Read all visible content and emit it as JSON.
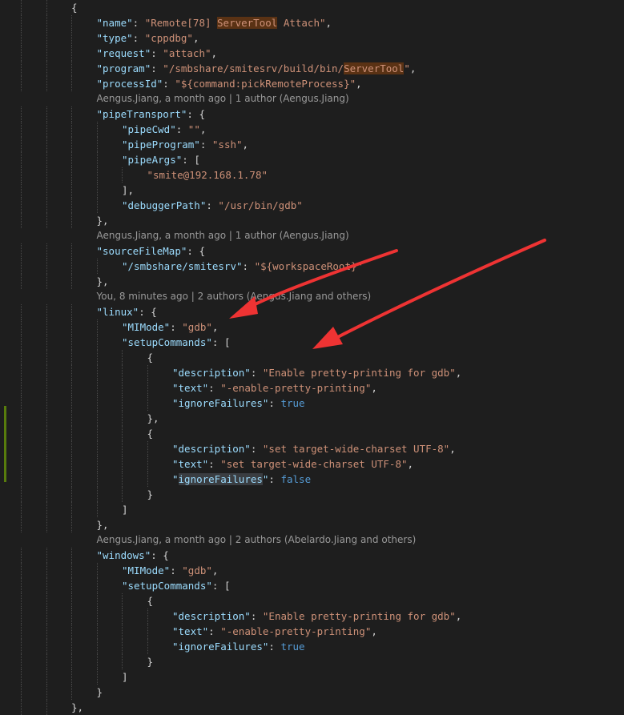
{
  "lines": [
    {
      "type": "code",
      "indent": 2,
      "tokens": [
        {
          "c": "punc",
          "t": "{"
        }
      ]
    },
    {
      "type": "code",
      "indent": 3,
      "tokens": [
        {
          "c": "key",
          "t": "\"name\""
        },
        {
          "c": "punc",
          "t": ": "
        },
        {
          "c": "str",
          "t": "\"Remote[78] "
        },
        {
          "c": "str hl",
          "t": "ServerTool"
        },
        {
          "c": "str",
          "t": " Attach\""
        },
        {
          "c": "punc",
          "t": ","
        }
      ]
    },
    {
      "type": "code",
      "indent": 3,
      "tokens": [
        {
          "c": "key",
          "t": "\"type\""
        },
        {
          "c": "punc",
          "t": ": "
        },
        {
          "c": "str",
          "t": "\"cppdbg\""
        },
        {
          "c": "punc",
          "t": ","
        }
      ]
    },
    {
      "type": "code",
      "indent": 3,
      "tokens": [
        {
          "c": "key",
          "t": "\"request\""
        },
        {
          "c": "punc",
          "t": ": "
        },
        {
          "c": "str",
          "t": "\"attach\""
        },
        {
          "c": "punc",
          "t": ","
        }
      ]
    },
    {
      "type": "code",
      "indent": 3,
      "tokens": [
        {
          "c": "key",
          "t": "\"program\""
        },
        {
          "c": "punc",
          "t": ": "
        },
        {
          "c": "str",
          "t": "\"/smbshare/smitesrv/build/bin/"
        },
        {
          "c": "str hl",
          "t": "ServerTool"
        },
        {
          "c": "str",
          "t": "\""
        },
        {
          "c": "punc",
          "t": ","
        }
      ]
    },
    {
      "type": "code",
      "indent": 3,
      "tokens": [
        {
          "c": "key",
          "t": "\"processId\""
        },
        {
          "c": "punc",
          "t": ": "
        },
        {
          "c": "str",
          "t": "\"${command:pickRemoteProcess}\""
        },
        {
          "c": "punc",
          "t": ","
        }
      ]
    },
    {
      "type": "lens",
      "indent": 3,
      "text": "Aengus.Jiang, a month ago | 1 author (Aengus.Jiang)"
    },
    {
      "type": "code",
      "indent": 3,
      "tokens": [
        {
          "c": "key",
          "t": "\"pipeTransport\""
        },
        {
          "c": "punc",
          "t": ": {"
        }
      ]
    },
    {
      "type": "code",
      "indent": 4,
      "tokens": [
        {
          "c": "key",
          "t": "\"pipeCwd\""
        },
        {
          "c": "punc",
          "t": ": "
        },
        {
          "c": "str",
          "t": "\"\""
        },
        {
          "c": "punc",
          "t": ","
        }
      ]
    },
    {
      "type": "code",
      "indent": 4,
      "tokens": [
        {
          "c": "key",
          "t": "\"pipeProgram\""
        },
        {
          "c": "punc",
          "t": ": "
        },
        {
          "c": "str",
          "t": "\"ssh\""
        },
        {
          "c": "punc",
          "t": ","
        }
      ]
    },
    {
      "type": "code",
      "indent": 4,
      "tokens": [
        {
          "c": "key",
          "t": "\"pipeArgs\""
        },
        {
          "c": "punc",
          "t": ": ["
        }
      ]
    },
    {
      "type": "code",
      "indent": 5,
      "tokens": [
        {
          "c": "str",
          "t": "\"smite@192.168.1.78\""
        }
      ]
    },
    {
      "type": "code",
      "indent": 4,
      "tokens": [
        {
          "c": "punc",
          "t": "],"
        }
      ]
    },
    {
      "type": "code",
      "indent": 4,
      "tokens": [
        {
          "c": "key",
          "t": "\"debuggerPath\""
        },
        {
          "c": "punc",
          "t": ": "
        },
        {
          "c": "str",
          "t": "\"/usr/bin/gdb\""
        }
      ]
    },
    {
      "type": "code",
      "indent": 3,
      "tokens": [
        {
          "c": "punc",
          "t": "},"
        }
      ]
    },
    {
      "type": "lens",
      "indent": 3,
      "text": "Aengus.Jiang, a month ago | 1 author (Aengus.Jiang)"
    },
    {
      "type": "code",
      "indent": 3,
      "tokens": [
        {
          "c": "key",
          "t": "\"sourceFileMap\""
        },
        {
          "c": "punc",
          "t": ": {"
        }
      ]
    },
    {
      "type": "code",
      "indent": 4,
      "tokens": [
        {
          "c": "key",
          "t": "\"/smbshare/smitesrv\""
        },
        {
          "c": "punc",
          "t": ": "
        },
        {
          "c": "str",
          "t": "\"${workspaceRoot}\""
        }
      ]
    },
    {
      "type": "code",
      "indent": 3,
      "tokens": [
        {
          "c": "punc",
          "t": "},"
        }
      ]
    },
    {
      "type": "lens",
      "indent": 3,
      "text": "You, 8 minutes ago | 2 authors (Aengus.Jiang and others)"
    },
    {
      "type": "code",
      "indent": 3,
      "tokens": [
        {
          "c": "key",
          "t": "\"linux\""
        },
        {
          "c": "punc",
          "t": ": {"
        }
      ]
    },
    {
      "type": "code",
      "indent": 4,
      "tokens": [
        {
          "c": "key",
          "t": "\"MIMode\""
        },
        {
          "c": "punc",
          "t": ": "
        },
        {
          "c": "str",
          "t": "\"gdb\""
        },
        {
          "c": "punc",
          "t": ","
        }
      ]
    },
    {
      "type": "code",
      "indent": 4,
      "tokens": [
        {
          "c": "key",
          "t": "\"setupCommands\""
        },
        {
          "c": "punc",
          "t": ": ["
        }
      ]
    },
    {
      "type": "code",
      "indent": 5,
      "tokens": [
        {
          "c": "punc",
          "t": "{"
        }
      ]
    },
    {
      "type": "code",
      "indent": 6,
      "tokens": [
        {
          "c": "key",
          "t": "\"description\""
        },
        {
          "c": "punc",
          "t": ": "
        },
        {
          "c": "str",
          "t": "\"Enable pretty-printing for gdb\""
        },
        {
          "c": "punc",
          "t": ","
        }
      ]
    },
    {
      "type": "code",
      "indent": 6,
      "tokens": [
        {
          "c": "key",
          "t": "\"text\""
        },
        {
          "c": "punc",
          "t": ": "
        },
        {
          "c": "str",
          "t": "\"-enable-pretty-printing\""
        },
        {
          "c": "punc",
          "t": ","
        }
      ]
    },
    {
      "type": "code",
      "indent": 6,
      "tokens": [
        {
          "c": "key",
          "t": "\"ignoreFailures\""
        },
        {
          "c": "punc",
          "t": ": "
        },
        {
          "c": "kw",
          "t": "true"
        }
      ]
    },
    {
      "type": "code",
      "indent": 5,
      "tokens": [
        {
          "c": "punc",
          "t": "},"
        }
      ]
    },
    {
      "type": "code",
      "indent": 5,
      "tokens": [
        {
          "c": "punc",
          "t": "{"
        }
      ]
    },
    {
      "type": "code",
      "indent": 6,
      "tokens": [
        {
          "c": "key",
          "t": "\"description\""
        },
        {
          "c": "punc",
          "t": ": "
        },
        {
          "c": "str",
          "t": "\"set target-wide-charset UTF-8\""
        },
        {
          "c": "punc",
          "t": ","
        }
      ]
    },
    {
      "type": "code",
      "indent": 6,
      "tokens": [
        {
          "c": "key",
          "t": "\"text\""
        },
        {
          "c": "punc",
          "t": ": "
        },
        {
          "c": "str",
          "t": "\"set target-wide-charset UTF-8\""
        },
        {
          "c": "punc",
          "t": ","
        }
      ]
    },
    {
      "type": "code",
      "indent": 6,
      "tokens": [
        {
          "c": "key",
          "t": "\""
        },
        {
          "c": "key sel",
          "t": "ignoreFailures"
        },
        {
          "c": "key",
          "t": "\""
        },
        {
          "c": "punc",
          "t": ": "
        },
        {
          "c": "kw",
          "t": "false"
        }
      ]
    },
    {
      "type": "code",
      "indent": 5,
      "tokens": [
        {
          "c": "punc",
          "t": "}"
        }
      ]
    },
    {
      "type": "code",
      "indent": 4,
      "tokens": [
        {
          "c": "punc",
          "t": "]"
        }
      ]
    },
    {
      "type": "code",
      "indent": 3,
      "tokens": [
        {
          "c": "punc",
          "t": "},"
        }
      ]
    },
    {
      "type": "lens",
      "indent": 3,
      "text": "Aengus.Jiang, a month ago | 2 authors (Abelardo.Jiang and others)"
    },
    {
      "type": "code",
      "indent": 3,
      "tokens": [
        {
          "c": "key",
          "t": "\"windows\""
        },
        {
          "c": "punc",
          "t": ": {"
        }
      ]
    },
    {
      "type": "code",
      "indent": 4,
      "tokens": [
        {
          "c": "key",
          "t": "\"MIMode\""
        },
        {
          "c": "punc",
          "t": ": "
        },
        {
          "c": "str",
          "t": "\"gdb\""
        },
        {
          "c": "punc",
          "t": ","
        }
      ]
    },
    {
      "type": "code",
      "indent": 4,
      "tokens": [
        {
          "c": "key",
          "t": "\"setupCommands\""
        },
        {
          "c": "punc",
          "t": ": ["
        }
      ]
    },
    {
      "type": "code",
      "indent": 5,
      "tokens": [
        {
          "c": "punc",
          "t": "{"
        }
      ]
    },
    {
      "type": "code",
      "indent": 6,
      "tokens": [
        {
          "c": "key",
          "t": "\"description\""
        },
        {
          "c": "punc",
          "t": ": "
        },
        {
          "c": "str",
          "t": "\"Enable pretty-printing for gdb\""
        },
        {
          "c": "punc",
          "t": ","
        }
      ]
    },
    {
      "type": "code",
      "indent": 6,
      "tokens": [
        {
          "c": "key",
          "t": "\"text\""
        },
        {
          "c": "punc",
          "t": ": "
        },
        {
          "c": "str",
          "t": "\"-enable-pretty-printing\""
        },
        {
          "c": "punc",
          "t": ","
        }
      ]
    },
    {
      "type": "code",
      "indent": 6,
      "tokens": [
        {
          "c": "key",
          "t": "\"ignoreFailures\""
        },
        {
          "c": "punc",
          "t": ": "
        },
        {
          "c": "kw",
          "t": "true"
        }
      ]
    },
    {
      "type": "code",
      "indent": 5,
      "tokens": [
        {
          "c": "punc",
          "t": "}"
        }
      ]
    },
    {
      "type": "code",
      "indent": 4,
      "tokens": [
        {
          "c": "punc",
          "t": "]"
        }
      ]
    },
    {
      "type": "code",
      "indent": 3,
      "tokens": [
        {
          "c": "punc",
          "t": "}"
        }
      ]
    },
    {
      "type": "code",
      "indent": 2,
      "tokens": [
        {
          "c": "punc",
          "t": "},"
        }
      ]
    }
  ],
  "colors": {
    "background": "#1e1e1e",
    "key": "#9cdcfe",
    "string": "#ce9178",
    "keyword": "#569cd6",
    "punctuation": "#d4d4d4",
    "codelens": "#999999",
    "search_highlight": "#5a3214",
    "word_highlight": "#3a3d41",
    "gutter_modified": "#587c0c",
    "annotation_arrow": "#ee3333"
  }
}
